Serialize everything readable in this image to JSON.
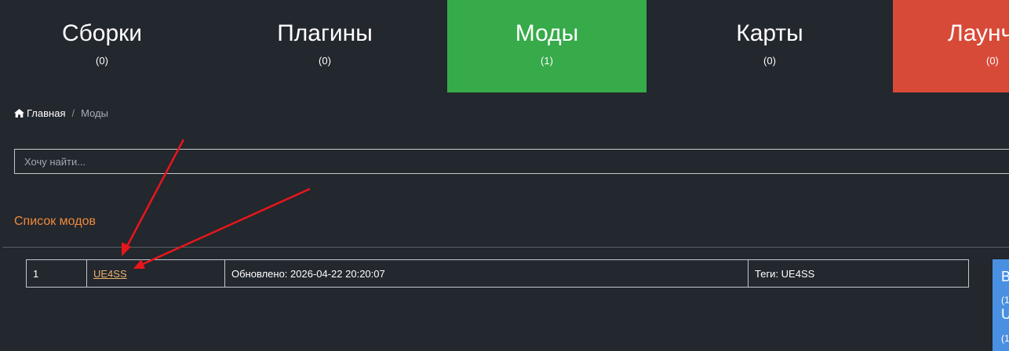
{
  "tabs": [
    {
      "title": "Сборки",
      "count": "(0)"
    },
    {
      "title": "Плагины",
      "count": "(0)"
    },
    {
      "title": "Моды",
      "count": "(1)"
    },
    {
      "title": "Карты",
      "count": "(0)"
    },
    {
      "title": "Лаунчеры",
      "count": "(0)"
    }
  ],
  "breadcrumb": {
    "home": "Главная",
    "separator": "/",
    "current": "Моды"
  },
  "search": {
    "placeholder": "Хочу найти..."
  },
  "section": {
    "title": "Список модов"
  },
  "table": {
    "rows": [
      {
        "num": "1",
        "name": "UE4SS",
        "updated": "Обновлено: 2026-04-22 20:20:07",
        "tags": "Теги: UE4SS"
      }
    ]
  },
  "side_card": {
    "line1": "В",
    "line2": "(1",
    "line3": "U",
    "line4": "(1"
  },
  "colors": {
    "background": "#23272e",
    "active_tab": "#37aa4a",
    "launchers_tab": "#d84a38",
    "section_title": "#f08a3c",
    "link": "#e9b46f",
    "side_card": "#4a90e2",
    "arrow": "#e8161b"
  },
  "icons": {
    "home": "home-icon"
  }
}
